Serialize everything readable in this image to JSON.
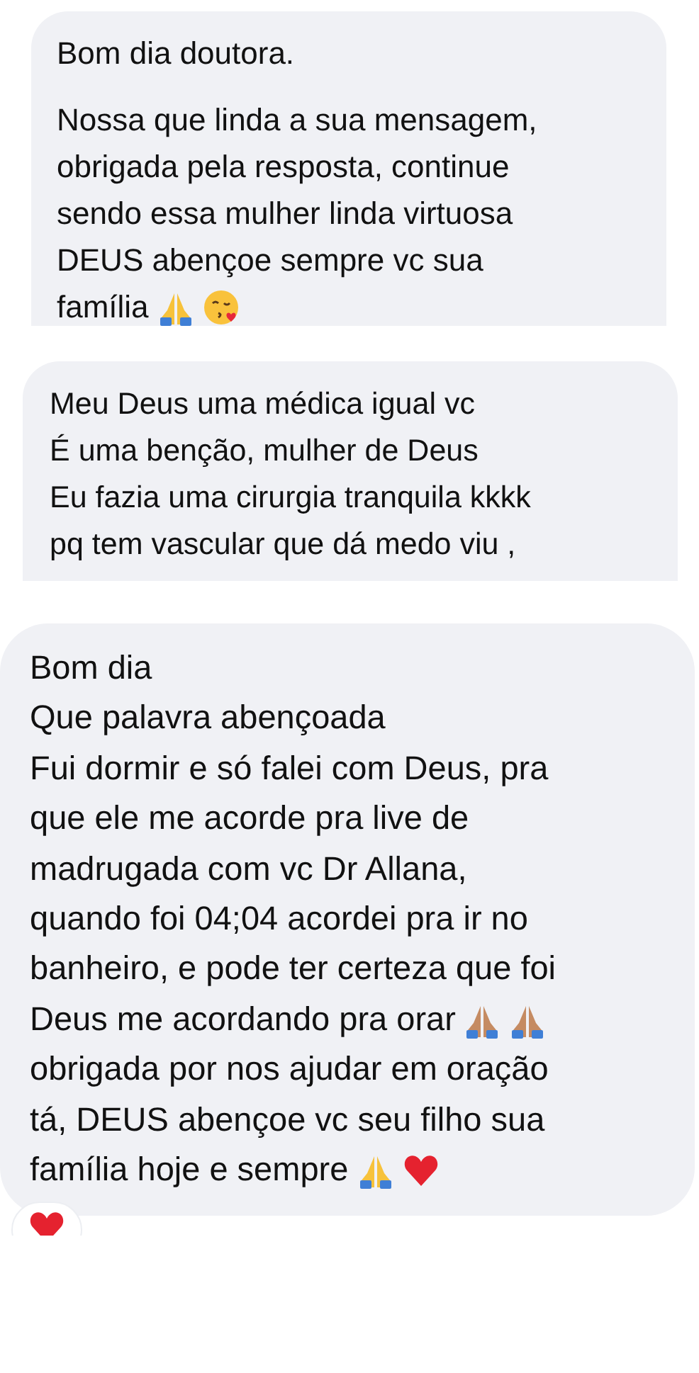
{
  "messages": [
    {
      "paragraphs": [
        [
          {
            "text": "Bom dia doutora."
          }
        ],
        [
          {
            "text": "Nossa que linda a sua mensagem,"
          },
          {
            "text": "obrigada pela resposta, continue"
          },
          {
            "text": "sendo essa mulher linda virtuosa"
          },
          {
            "text": "DEUS abençoe sempre vc sua"
          },
          {
            "text": "família",
            "icons": [
              {
                "kind": "pray"
              },
              {
                "kind": "kiss"
              }
            ]
          }
        ]
      ]
    },
    {
      "paragraphs": [
        [
          {
            "text": "Meu Deus uma médica igual vc"
          },
          {
            "text": "É uma benção, mulher de Deus"
          },
          {
            "text": "Eu fazia uma cirurgia tranquila kkkk"
          },
          {
            "text": "pq tem vascular que dá medo viu ,"
          }
        ]
      ]
    },
    {
      "paragraphs": [
        [
          {
            "text": "Bom dia"
          },
          {
            "text": "Que palavra abençoada"
          },
          {
            "text": "Fui dormir e só falei com Deus, pra"
          },
          {
            "text": "que ele me acorde pra live de"
          },
          {
            "text": "madrugada com vc Dr Allana,"
          },
          {
            "text": "quando foi 04;04 acordei pra ir no"
          },
          {
            "text": "banheiro, e pode ter certeza que foi"
          },
          {
            "text": "Deus me acordando pra orar",
            "icons": [
              {
                "kind": "pray_tan"
              },
              {
                "kind": "pray_tan"
              }
            ]
          },
          {
            "text": "obrigada por nos ajudar em oração"
          },
          {
            "text": "tá, DEUS abençoe vc seu filho sua"
          },
          {
            "text": "família hoje e sempre",
            "icons": [
              {
                "kind": "pray"
              },
              {
                "kind": "heart"
              }
            ]
          }
        ]
      ],
      "reaction": {
        "kind": "heart"
      }
    }
  ]
}
